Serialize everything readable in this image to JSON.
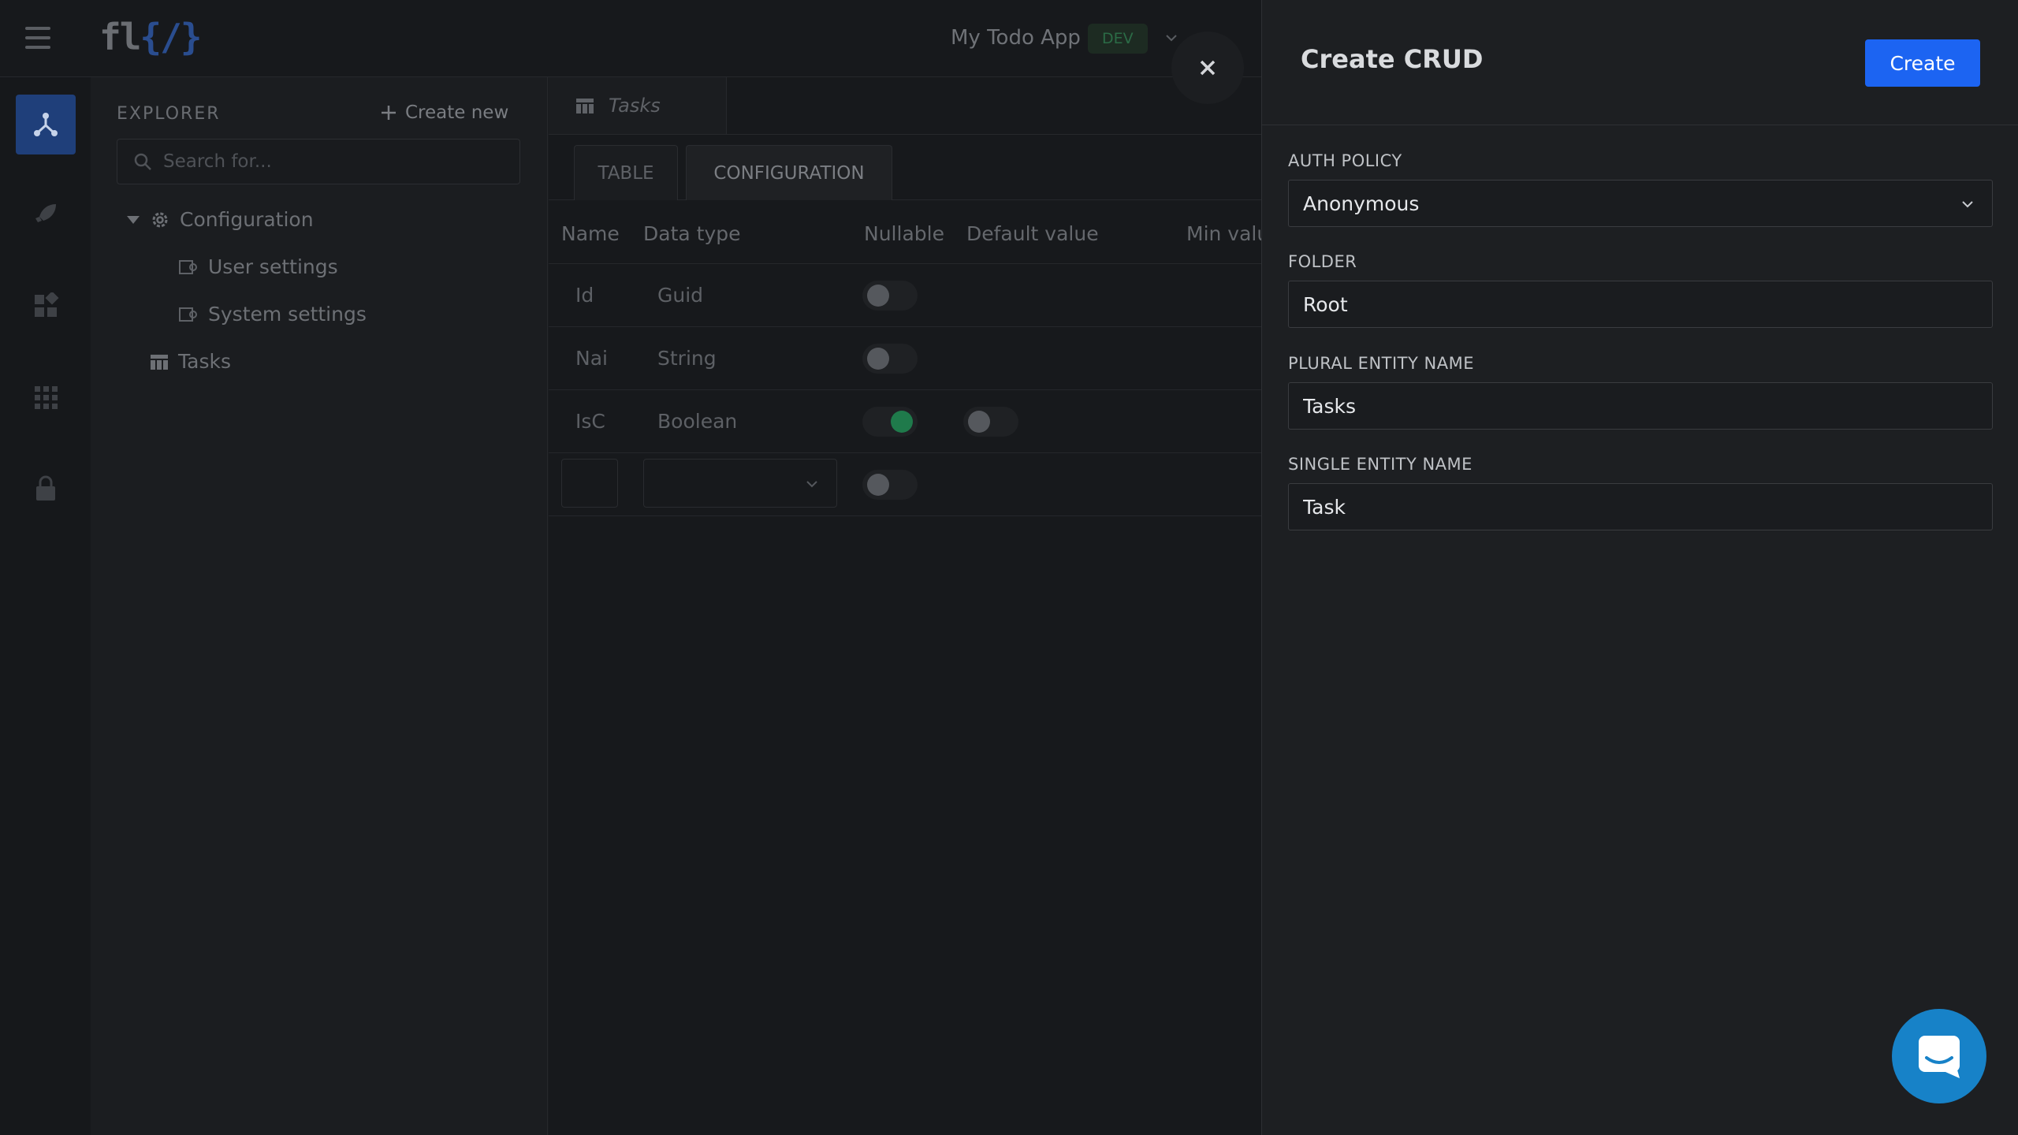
{
  "header": {
    "logo_text_left": "fl",
    "logo_text_brace": "{/}",
    "app_name": "My Todo App",
    "env_badge": "DEV"
  },
  "rail": {
    "items": [
      {
        "name": "explorer",
        "icon": "graph-icon",
        "active": true
      },
      {
        "name": "deploy",
        "icon": "rocket-icon",
        "active": false
      },
      {
        "name": "components",
        "icon": "widgets-icon",
        "active": false
      },
      {
        "name": "apps",
        "icon": "grid-icon",
        "active": false
      },
      {
        "name": "security",
        "icon": "lock-icon",
        "active": false
      }
    ]
  },
  "explorer": {
    "title": "EXPLORER",
    "create_new": "Create new",
    "search_placeholder": "Search for...",
    "tree": {
      "configuration": "Configuration",
      "user_settings": "User settings",
      "system_settings": "System settings",
      "tasks": "Tasks"
    }
  },
  "main": {
    "doc_tab": "Tasks",
    "tabs": {
      "table": "TABLE",
      "configuration": "CONFIGURATION"
    },
    "columns": {
      "name": "Name",
      "data_type": "Data type",
      "nullable": "Nullable",
      "default_value": "Default value",
      "min_value": "Min valu"
    },
    "rows": [
      {
        "name": "Id",
        "type": "Guid",
        "nullable": false
      },
      {
        "name": "Nai",
        "type": "String",
        "nullable": false
      },
      {
        "name": "IsC",
        "type": "Boolean",
        "nullable": true,
        "default": false
      }
    ]
  },
  "drawer": {
    "title": "Create CRUD",
    "create_button": "Create",
    "auth_policy": {
      "label": "AUTH POLICY",
      "value": "Anonymous"
    },
    "folder": {
      "label": "FOLDER",
      "value": "Root"
    },
    "plural_entity_name": {
      "label": "PLURAL ENTITY NAME",
      "value": "Tasks"
    },
    "single_entity_name": {
      "label": "SINGLE ENTITY NAME",
      "value": "Task"
    }
  },
  "colors": {
    "primary": "#1c64f2",
    "chat": "#1782c8",
    "toggle_on": "#1f7a4b"
  }
}
